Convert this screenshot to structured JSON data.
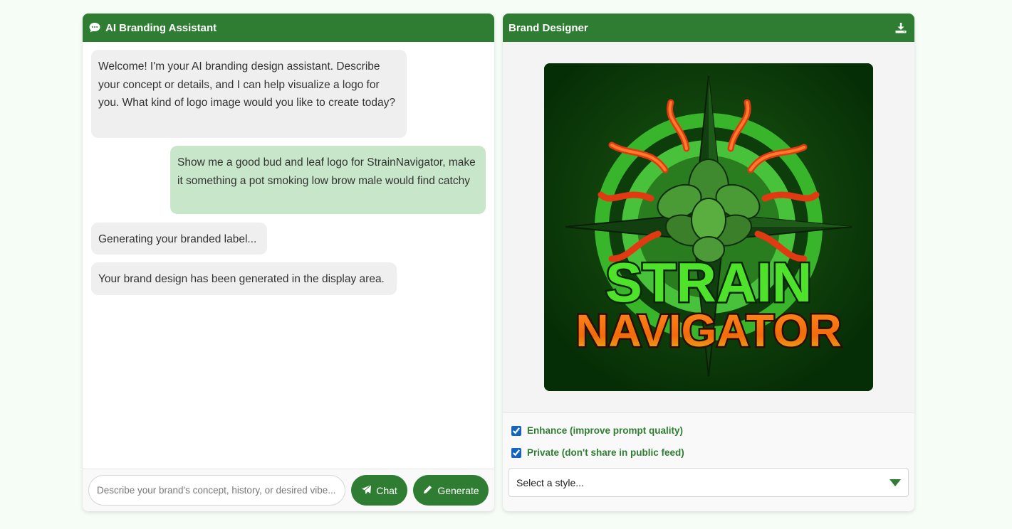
{
  "chat_panel": {
    "title": "AI Branding Assistant",
    "icon": "speech-bubble-icon",
    "messages": [
      {
        "role": "bot",
        "text": "Welcome! I'm your AI branding design assistant. Describe your concept or details, and I can help visualize a logo for you. What kind of logo image would you like to create today?"
      },
      {
        "role": "user",
        "text": "Show me a good bud and leaf logo for StrainNavigator, make it something a pot smoking low brow male would find catchy"
      },
      {
        "role": "bot",
        "text": "Generating your branded label..."
      },
      {
        "role": "bot",
        "text": "Your brand design has been generated in the display area."
      }
    ],
    "input_placeholder": "Describe your brand's concept, history, or desired vibe...",
    "chat_button": "Chat",
    "generate_button": "Generate"
  },
  "designer_panel": {
    "title": "Brand Designer",
    "download_icon": "download-icon",
    "logo": {
      "line1": "STRAIN",
      "line2": "NAVIGATOR"
    },
    "enhance_label": "Enhance (improve prompt quality)",
    "enhance_checked": true,
    "private_label": "Private (don't share in public feed)",
    "private_checked": true,
    "style_select_value": "Select a style..."
  },
  "colors": {
    "accent": "#2e7d32",
    "user_bubble": "#c8e6c9",
    "bot_bubble": "#efefef",
    "checkbox": "#1565c0"
  }
}
